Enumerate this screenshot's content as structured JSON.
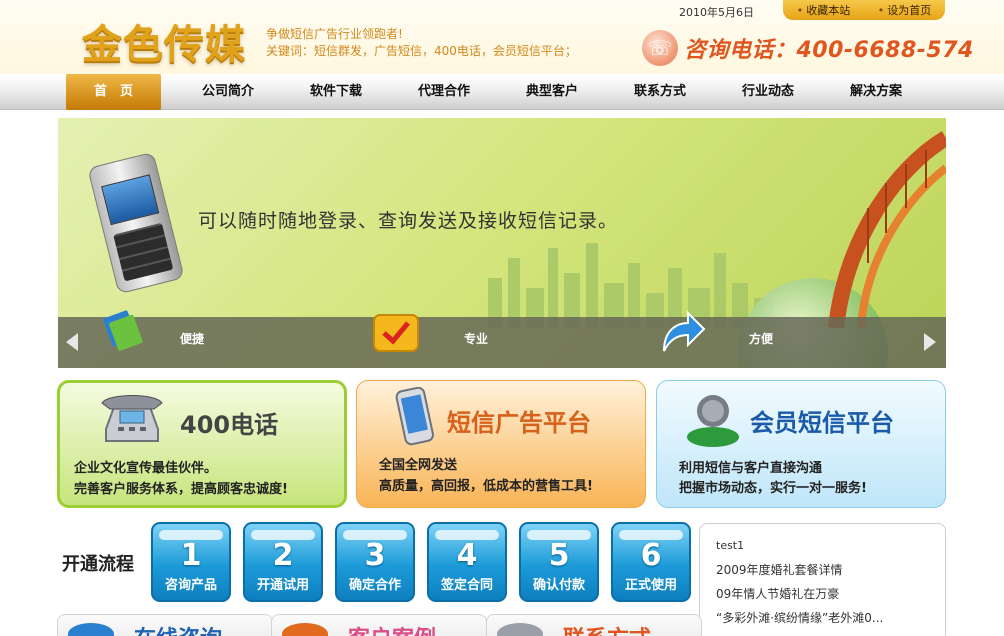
{
  "header": {
    "logo_text": "金色传媒",
    "slogan_line1": "争做短信广告行业领跑者!",
    "slogan_line2": "关键词：短信群发，广告短信，400电话，会员短信平台；",
    "date": "2010年5月6日",
    "bookmark_label": "收藏本站",
    "homepage_label": "设为首页",
    "hotline": "咨询电话：400-6688-574"
  },
  "nav": {
    "items": [
      "首　页",
      "公司简介",
      "软件下载",
      "代理合作",
      "典型客户",
      "联系方式",
      "行业动态",
      "解决方案"
    ]
  },
  "banner": {
    "text": "可以随时随地登录、查询发送及接收短信记录。",
    "features": [
      "便捷",
      "专业",
      "方便"
    ]
  },
  "features": [
    {
      "title": "400电话",
      "line1": "企业文化宣传最佳伙伴。",
      "line2": "完善客户服务体系，提高顾客忠诚度!"
    },
    {
      "title": "短信广告平台",
      "line1": "全国全网发送",
      "line2": "高质量，高回报，低成本的营售工具!"
    },
    {
      "title": "会员短信平台",
      "line1": "利用短信与客户直接沟通",
      "line2": "把握市场动态，实行一对一服务!"
    }
  ],
  "process": {
    "title": "开通流程",
    "steps": [
      {
        "num": "1",
        "label": "咨询产品"
      },
      {
        "num": "2",
        "label": "开通试用"
      },
      {
        "num": "3",
        "label": "确定合作"
      },
      {
        "num": "4",
        "label": "签定合同"
      },
      {
        "num": "5",
        "label": "确认付款"
      },
      {
        "num": "6",
        "label": "正式使用"
      }
    ]
  },
  "news": {
    "items": [
      "test1",
      "2009年度婚礼套餐详情",
      "09年情人节婚礼在万豪",
      "“多彩外滩·缤纷情缘”老外滩0..."
    ]
  },
  "bottom": {
    "box1": "在线咨询",
    "box2": "客户案例",
    "box3": "联系方式"
  },
  "colors": {
    "accent_gold": "#e0a21a",
    "hotline_orange": "#e0561f",
    "nav_active": "#c47a05",
    "step_blue": "#1c9bd8"
  }
}
